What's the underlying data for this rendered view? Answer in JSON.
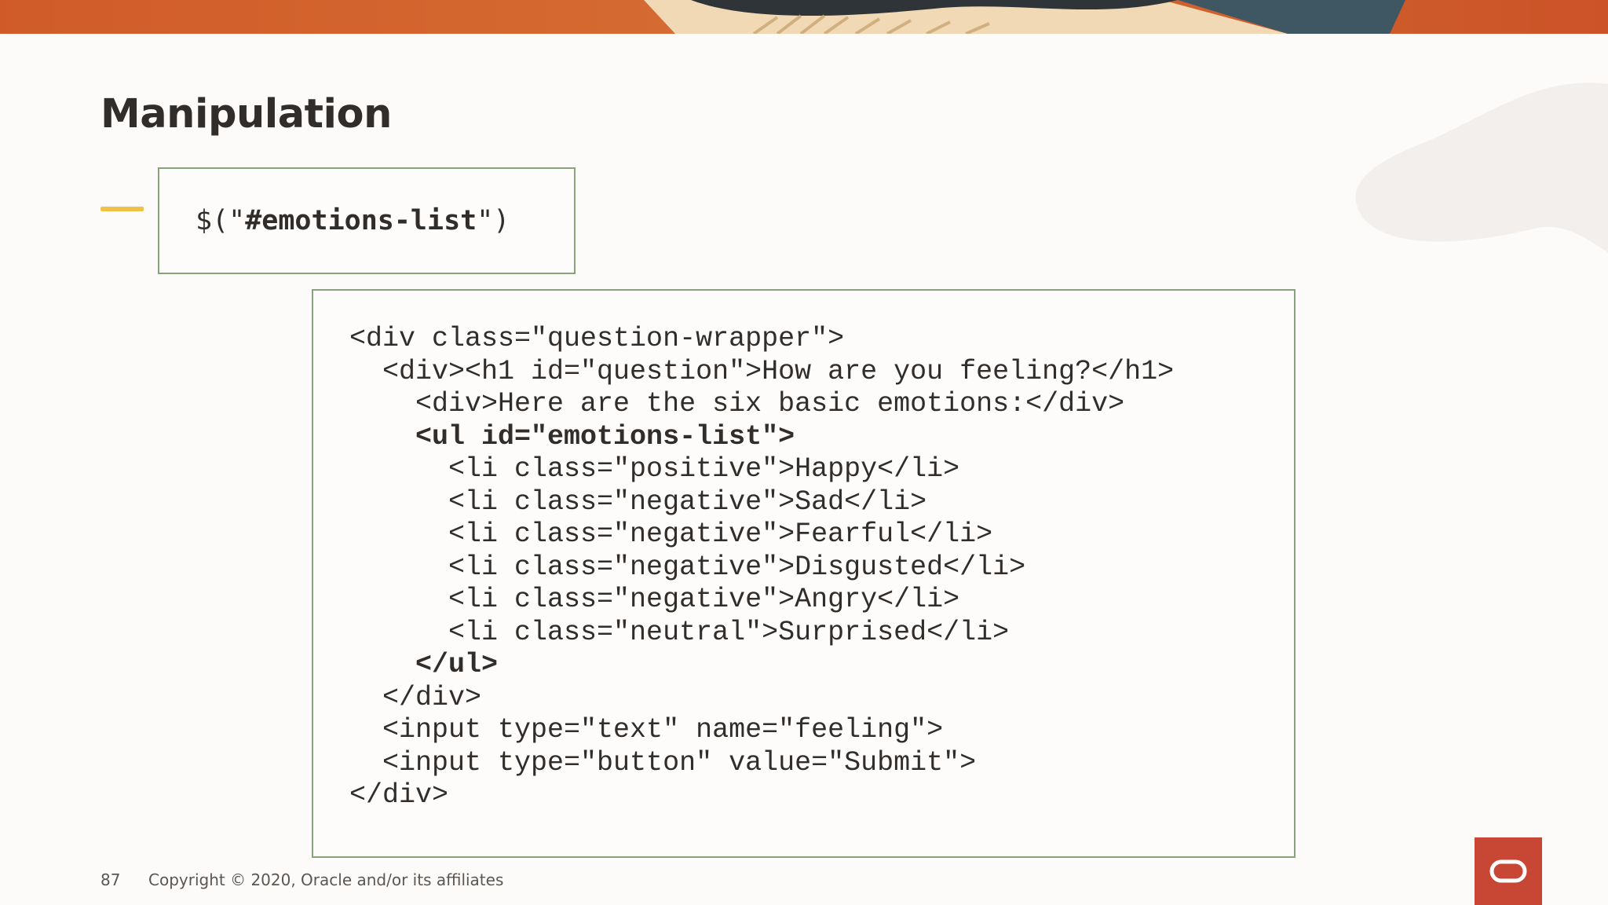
{
  "slide": {
    "title": "Manipulation",
    "page_number": "87",
    "copyright": "Copyright © 2020, Oracle and/or its affiliates"
  },
  "selector": {
    "prefix": "$(\"",
    "value": "#emotions-list",
    "suffix": "\")"
  },
  "code": {
    "lines": [
      {
        "text": "<div class=\"question-wrapper\">",
        "bold": false
      },
      {
        "text": "  <div><h1 id=\"question\">How are you feeling?</h1>",
        "bold": false
      },
      {
        "text": "    <div>Here are the six basic emotions:</div>",
        "bold": false
      },
      {
        "text": "    <ul id=\"emotions-list\">",
        "bold": true
      },
      {
        "text": "      <li class=\"positive\">Happy</li>",
        "bold": false
      },
      {
        "text": "      <li class=\"negative\">Sad</li>",
        "bold": false
      },
      {
        "text": "      <li class=\"negative\">Fearful</li>",
        "bold": false
      },
      {
        "text": "      <li class=\"negative\">Disgusted</li>",
        "bold": false
      },
      {
        "text": "      <li class=\"negative\">Angry</li>",
        "bold": false
      },
      {
        "text": "      <li class=\"neutral\">Surprised</li>",
        "bold": false
      },
      {
        "text": "    </ul>",
        "bold": true
      },
      {
        "text": "  </div>",
        "bold": false
      },
      {
        "text": "  <input type=\"text\" name=\"feeling\">",
        "bold": false
      },
      {
        "text": "  <input type=\"button\" value=\"Submit\">",
        "bold": false
      },
      {
        "text": "</div>",
        "bold": false
      }
    ]
  },
  "colors": {
    "border": "#86a37a",
    "accent": "#f0c049",
    "brand": "#c74634",
    "text": "#312d2a"
  },
  "icons": {
    "logo": "oracle-logo-icon"
  }
}
